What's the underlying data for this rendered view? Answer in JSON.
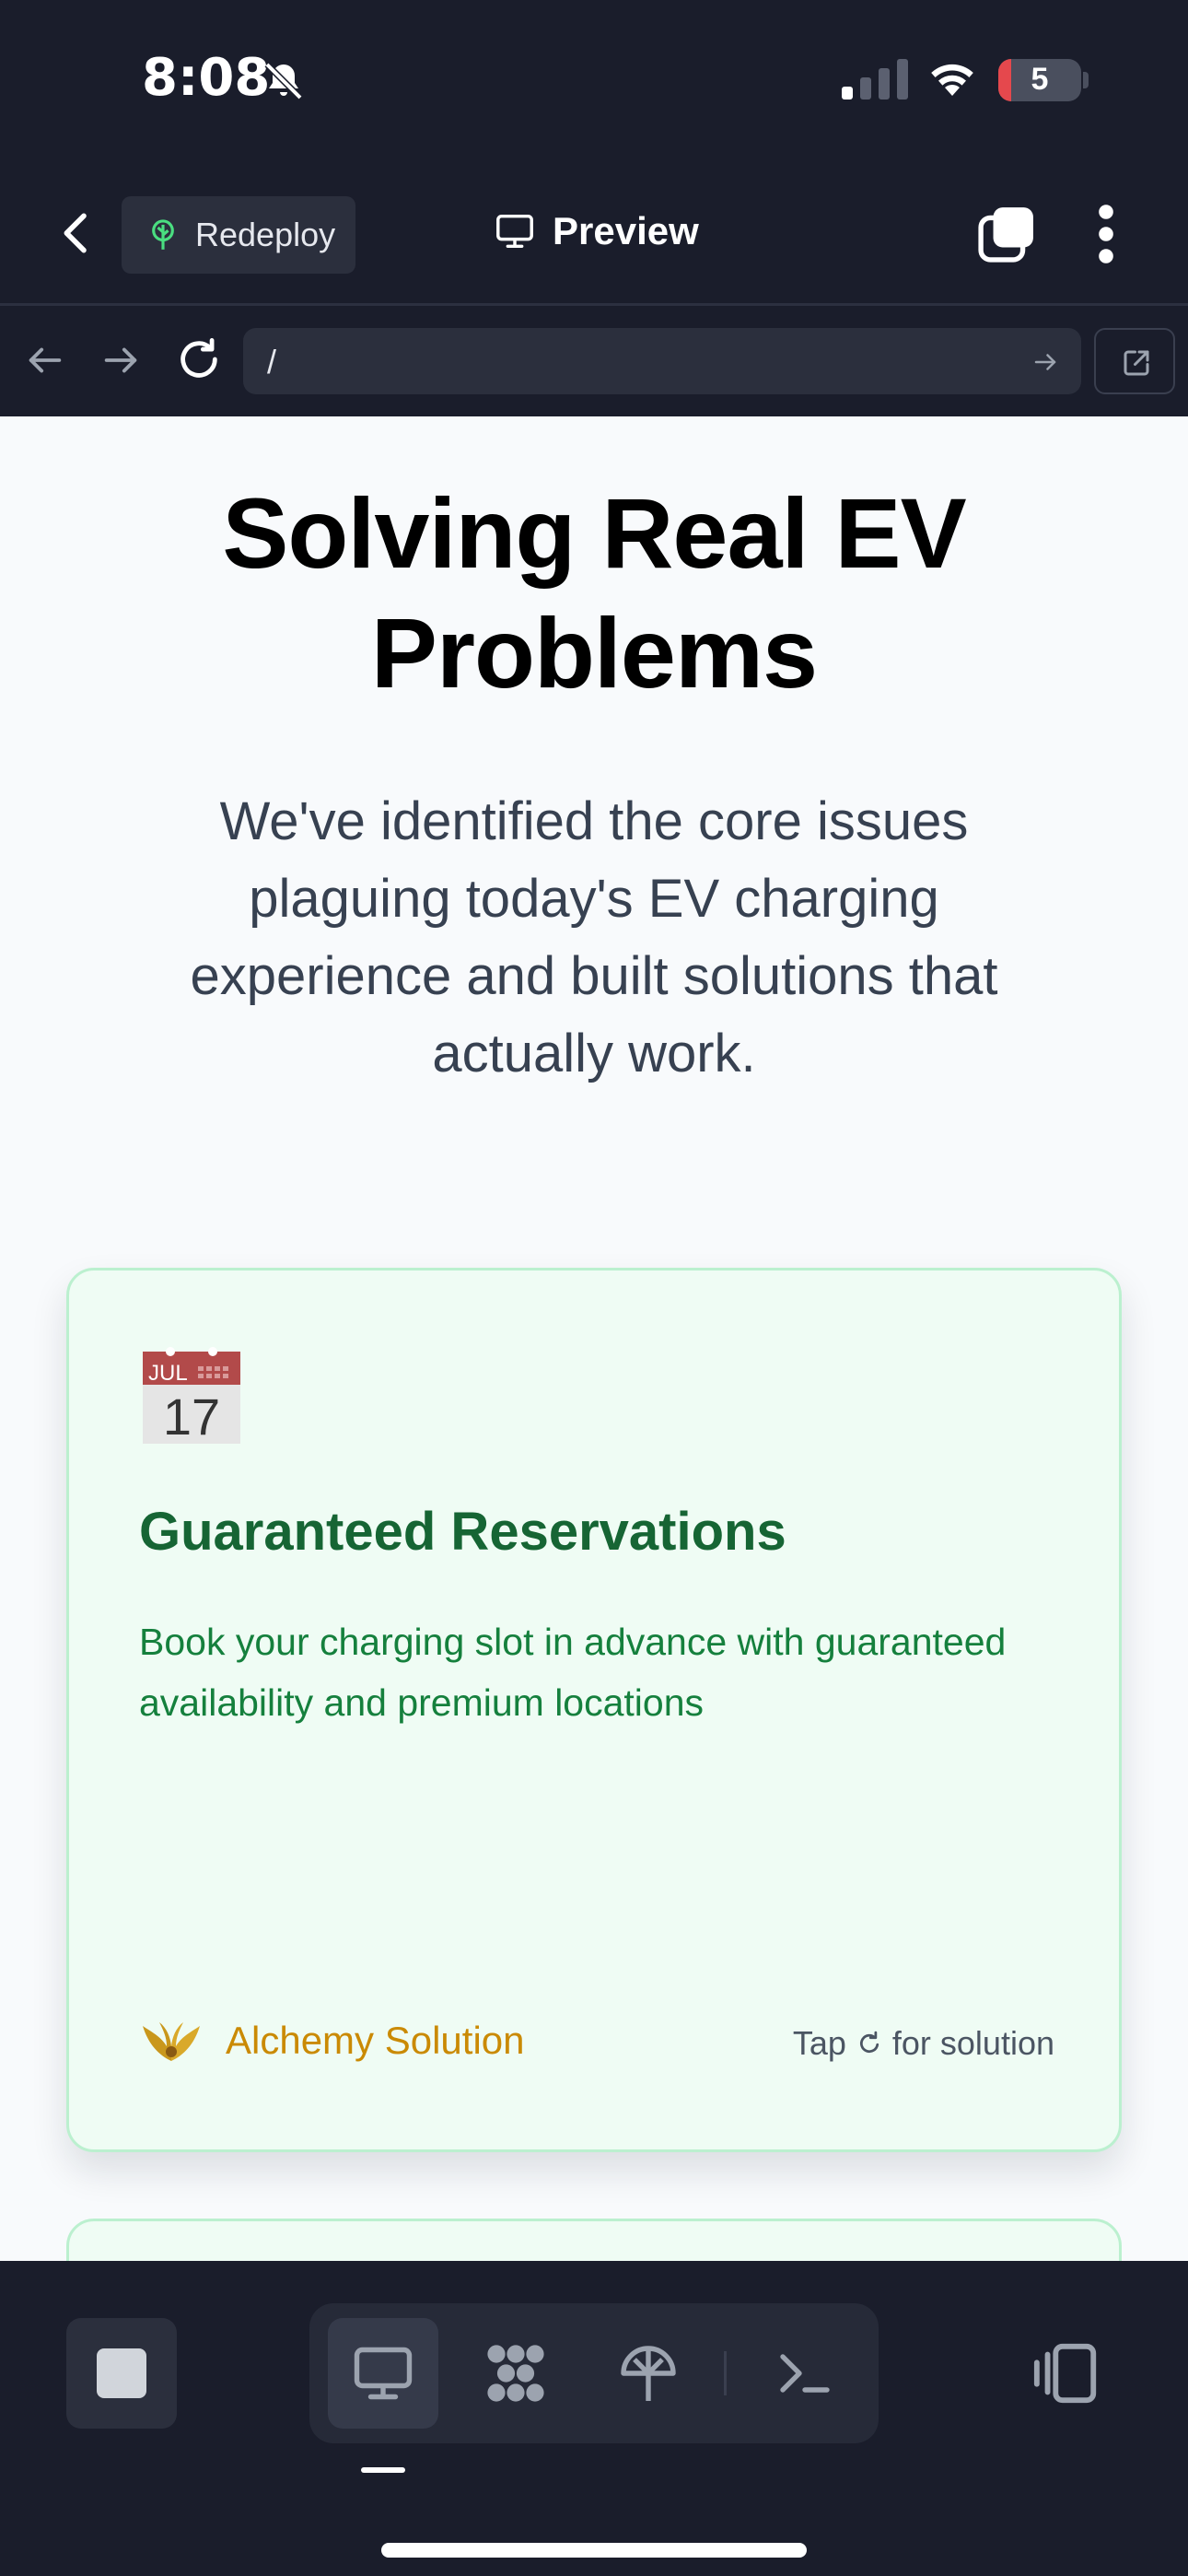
{
  "status_bar": {
    "time": "8:08",
    "battery_level": "5"
  },
  "app_header": {
    "redeploy_label": "Redeploy",
    "title": "Preview"
  },
  "browser": {
    "url": "/"
  },
  "hero": {
    "title": "Solving Real EV Problems",
    "subtitle": "We've identified the core issues plaguing today's EV charging experience and built solutions that actually work."
  },
  "card": {
    "icon_month": "JUL",
    "icon_day": "17",
    "title": "Guaranteed Reservations",
    "description": "Book your charging slot in advance with guaranteed availability and premium locations",
    "solution_label": "Alchemy Solution",
    "tap_prefix": "Tap",
    "tap_suffix": "for solution"
  },
  "colors": {
    "chrome_bg": "#1a1d2b",
    "card_bg": "#effcf4",
    "card_border": "#bbf0cf",
    "card_title": "#166534",
    "card_text": "#15803d",
    "accent_gold": "#ca8a04"
  },
  "icons": {
    "toolbar": [
      "stop-icon",
      "desktop-icon",
      "apps-icon",
      "deploy-icon",
      "terminal-icon",
      "device-toggle-icon"
    ]
  }
}
